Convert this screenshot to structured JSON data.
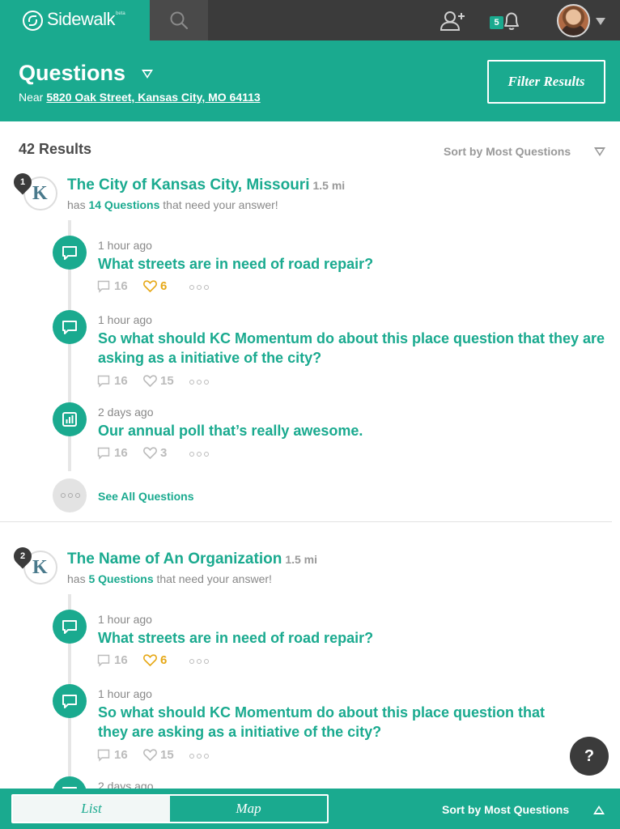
{
  "app": {
    "logo_text": "Sidewalk",
    "logo_beta": "beta",
    "notification_count": "5",
    "accent_color": "#1aaa8f",
    "topbar_color": "#3b3b3b",
    "like_color": "#e6a817"
  },
  "header": {
    "title": "Questions",
    "near_label": "Near",
    "near_address": "5820 Oak Street, Kansas City, MO 64113",
    "filter_label": "Filter Results"
  },
  "results": {
    "count_label": "42 Results",
    "sort_label": "Sort by Most Questions"
  },
  "orgs": [
    {
      "rank": "1",
      "name": "The City of Kansas City, Missouri",
      "distance": "1.5 mi",
      "sub_prefix": "has",
      "sub_count": "14 Questions",
      "sub_suffix": "that need your answer!",
      "questions": [
        {
          "icon": "speech-bubble-icon",
          "time": "1 hour ago",
          "title": "What streets are in need of road repair?",
          "answers": "16",
          "likes": "6",
          "liked": true
        },
        {
          "icon": "speech-bubble-icon",
          "time": "1 hour ago",
          "title": "So what should KC Momentum do about this place question that they are asking as a initiative of the city?",
          "answers": "16",
          "likes": "15",
          "liked": false
        },
        {
          "icon": "poll-chart-icon",
          "time": "2 days ago",
          "title": "Our annual poll that’s really awesome.",
          "answers": "16",
          "likes": "3",
          "liked": false
        }
      ],
      "see_all_label": "See All Questions"
    },
    {
      "rank": "2",
      "name": "The Name of An Organization",
      "distance": "1.5 mi",
      "sub_prefix": "has",
      "sub_count": "5 Questions",
      "sub_suffix": "that need your answer!",
      "questions": [
        {
          "icon": "speech-bubble-icon",
          "time": "1 hour ago",
          "title": "What streets are in need of road repair?",
          "answers": "16",
          "likes": "6",
          "liked": true
        },
        {
          "icon": "speech-bubble-icon",
          "time": "1 hour ago",
          "title": "So what should KC Momentum do about this place question that they are asking as a initiative of the city?",
          "answers": "16",
          "likes": "15",
          "liked": false
        },
        {
          "icon": "speech-bubble-icon",
          "time": "2 days ago",
          "title": "",
          "answers": "",
          "likes": "",
          "liked": false
        }
      ]
    }
  ],
  "help": {
    "label": "?"
  },
  "bottombar": {
    "list_label": "List",
    "map_label": "Map",
    "sort_label": "Sort by Most Questions"
  }
}
